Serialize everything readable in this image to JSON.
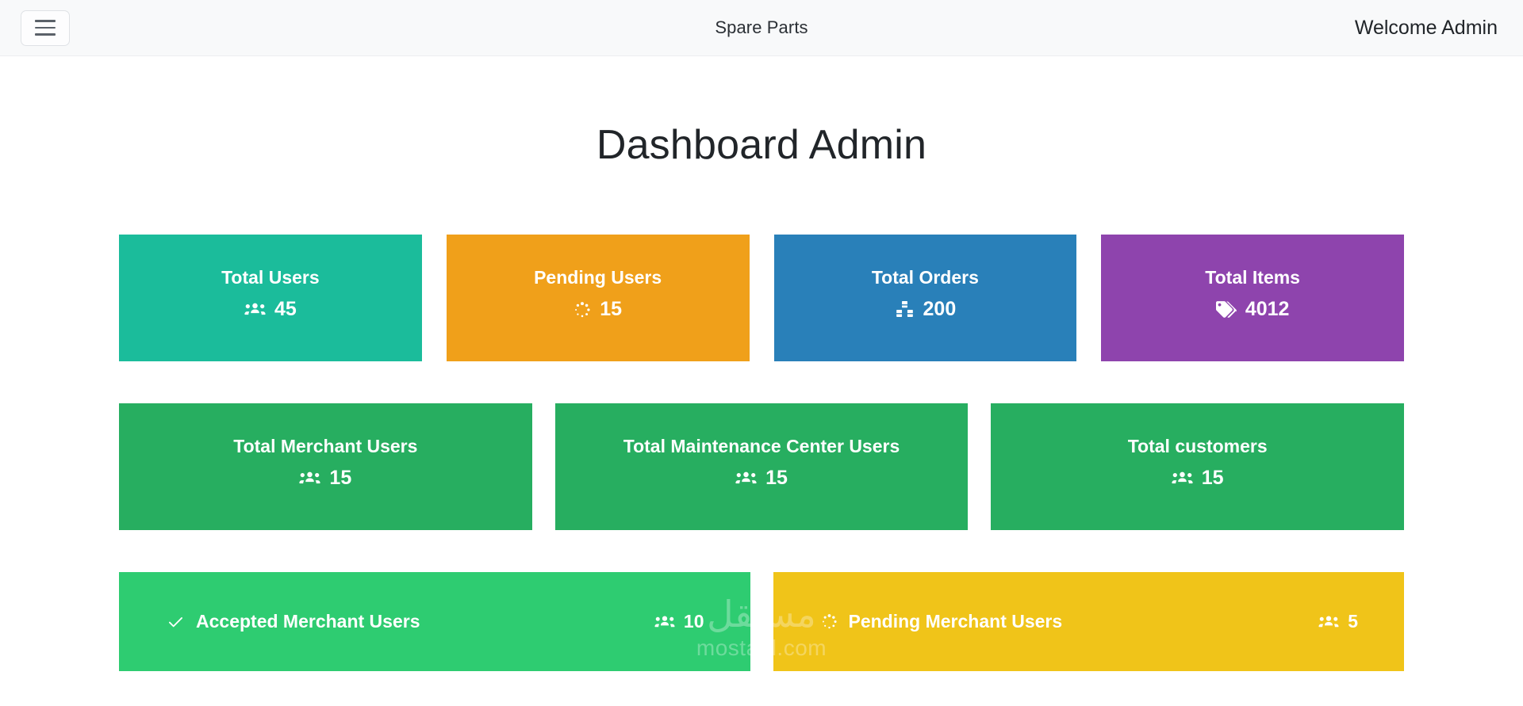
{
  "header": {
    "menu_button_label": "menu",
    "brand": "Spare Parts",
    "user_greeting": "Welcome Admin"
  },
  "page": {
    "title": "Dashboard Admin"
  },
  "colors": {
    "teal": "#1bbc9b",
    "orange": "#f0a01a",
    "blue": "#2980b9",
    "purple": "#8e44ad",
    "green": "#27ae60",
    "bright_green": "#2ecc71",
    "yellow": "#f0c419",
    "header_bg": "#f8f9fa",
    "text_dark": "#212529"
  },
  "stat_cards": [
    {
      "title": "Total Users",
      "value": "45",
      "icon": "users-icon",
      "color": "#1bbc9b"
    },
    {
      "title": "Pending Users",
      "value": "15",
      "icon": "spinner-icon",
      "color": "#f0a01a"
    },
    {
      "title": "Total Orders",
      "value": "200",
      "icon": "boxes-icon",
      "color": "#2980b9"
    },
    {
      "title": "Total Items",
      "value": "4012",
      "icon": "tags-icon",
      "color": "#8e44ad"
    }
  ],
  "green_cards": [
    {
      "title": "Total Merchant Users",
      "value": "15",
      "icon": "users-icon",
      "color": "#27ae60"
    },
    {
      "title": "Total Maintenance Center Users",
      "value": "15",
      "icon": "users-icon",
      "color": "#27ae60"
    },
    {
      "title": "Total customers",
      "value": "15",
      "icon": "users-icon",
      "color": "#27ae60"
    }
  ],
  "bar_cards": [
    {
      "title": "Accepted Merchant Users",
      "value": "10",
      "leading_icon": "check-icon",
      "trailing_icon": "users-icon",
      "color": "#2ecc71"
    },
    {
      "title": "Pending Merchant Users",
      "value": "5",
      "leading_icon": "spinner-icon",
      "trailing_icon": "users-icon",
      "color": "#f0c419"
    }
  ],
  "watermark": {
    "arabic": "مستقل",
    "latin": "mostaql.com"
  }
}
